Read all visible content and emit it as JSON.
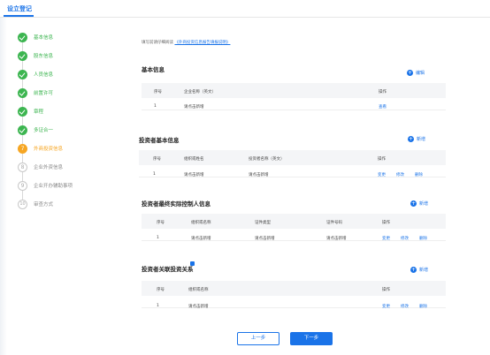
{
  "header": {
    "title": "设立登记"
  },
  "steps": [
    {
      "label": "基本信息",
      "state": "done",
      "marker": ""
    },
    {
      "label": "股东信息",
      "state": "done",
      "marker": ""
    },
    {
      "label": "人员信息",
      "state": "done",
      "marker": ""
    },
    {
      "label": "前置许可",
      "state": "done",
      "marker": ""
    },
    {
      "label": "章程",
      "state": "done",
      "marker": ""
    },
    {
      "label": "多证合一",
      "state": "done",
      "marker": ""
    },
    {
      "label": "外商投资信息",
      "state": "current",
      "marker": "7"
    },
    {
      "label": "企业外资信息",
      "state": "todo",
      "marker": "8"
    },
    {
      "label": "企业开办辅助事项",
      "state": "todo",
      "marker": "9"
    },
    {
      "label": "审查方式",
      "state": "todo",
      "marker": "10"
    }
  ],
  "hint": {
    "prefix": "填写前请仔细阅读",
    "link": "《外商投资信息报告填报说明》"
  },
  "sections": {
    "basic": {
      "title": "基本信息",
      "add_label": "编辑",
      "headers": [
        "序号",
        "企业名称（英文）",
        "操作"
      ],
      "rows": [
        {
          "no": "1",
          "name": "请点击新增",
          "actions": [
            "查看"
          ]
        }
      ]
    },
    "investor": {
      "title": "投资者基本信息",
      "add_label": "新增",
      "headers": [
        "序号",
        "组织或姓名",
        "投资者名称（英文）",
        "操作"
      ],
      "rows": [
        {
          "no": "1",
          "name": "请点击新增",
          "en": "请点击新增",
          "actions": [
            "变更",
            "修改",
            "删除"
          ]
        }
      ]
    },
    "controller": {
      "title": "投资者最终实际控制人信息",
      "add_label": "新增",
      "headers": [
        "序号",
        "组织或名称",
        "证件类型",
        "证件号码",
        "操作"
      ],
      "rows": [
        {
          "no": "1",
          "name": "请点击新增",
          "type": "请点击新增",
          "number": "请点击新增",
          "actions": [
            "变更",
            "修改",
            "删除"
          ]
        }
      ]
    },
    "relation": {
      "title": "投资者关联投资关系",
      "add_label": "新增",
      "headers": [
        "序号",
        "组织或名称",
        "操作"
      ],
      "rows": [
        {
          "no": "1",
          "name": "请点击新增",
          "actions": [
            "变更",
            "修改",
            "删除"
          ]
        }
      ]
    }
  },
  "footer": {
    "prev_label": "上一步",
    "next_label": "下一步"
  },
  "colors": {
    "primary": "#1a73e8",
    "done": "#3cb550",
    "current": "#f6a623"
  }
}
